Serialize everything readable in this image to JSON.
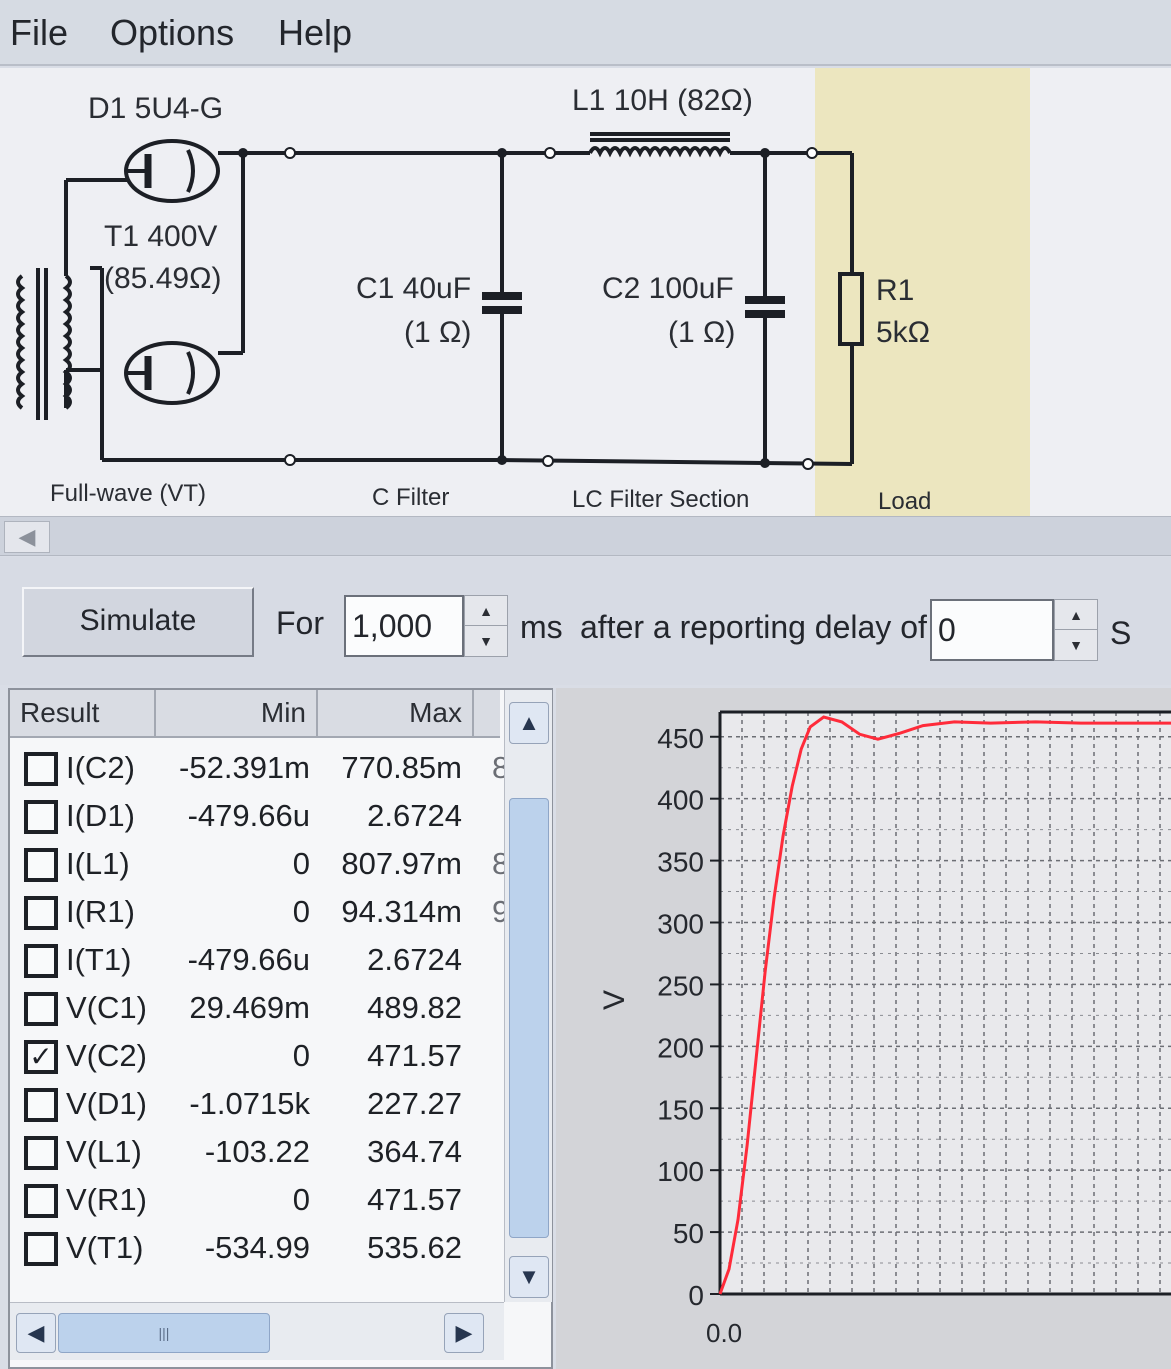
{
  "menu": {
    "file": "File",
    "options": "Options",
    "help": "Help"
  },
  "schematic": {
    "d1_label": "D1 5U4-G",
    "t1_label": "T1 400V",
    "t1_resistance": "(85.49Ω)",
    "l1_label": "L1 10H (82Ω)",
    "c1_label": "C1 40uF",
    "c1_resistance": "(1 Ω)",
    "c2_label": "C2 100uF",
    "c2_resistance": "(1 Ω)",
    "r1_label": "R1",
    "r1_value": "5kΩ",
    "sections": {
      "fullwave": "Full-wave (VT)",
      "c_filter": "C Filter",
      "lc_filter": "LC Filter Section",
      "load": "Load"
    },
    "load_band_color": "#ece6bf"
  },
  "controls": {
    "simulate_label": "Simulate",
    "for_label": "For",
    "duration_value": "1,000",
    "duration_unit": "ms",
    "delay_label": "after a reporting delay of",
    "delay_value": "0",
    "delay_unit": "S"
  },
  "results": {
    "columns": [
      "Result",
      "Min",
      "Max"
    ],
    "rows": [
      {
        "name": "I(C2)",
        "min": "-52.391m",
        "max": "770.85m",
        "checked": false,
        "cut": "8"
      },
      {
        "name": "I(D1)",
        "min": "-479.66u",
        "max": "2.6724",
        "checked": false,
        "cut": ""
      },
      {
        "name": "I(L1)",
        "min": "0",
        "max": "807.97m",
        "checked": false,
        "cut": "8"
      },
      {
        "name": "I(R1)",
        "min": "0",
        "max": "94.314m",
        "checked": false,
        "cut": "9"
      },
      {
        "name": "I(T1)",
        "min": "-479.66u",
        "max": "2.6724",
        "checked": false,
        "cut": ""
      },
      {
        "name": "V(C1)",
        "min": "29.469m",
        "max": "489.82",
        "checked": false,
        "cut": ""
      },
      {
        "name": "V(C2)",
        "min": "0",
        "max": "471.57",
        "checked": true,
        "cut": ""
      },
      {
        "name": "V(D1)",
        "min": "-1.0715k",
        "max": "227.27",
        "checked": false,
        "cut": ""
      },
      {
        "name": "V(L1)",
        "min": "-103.22",
        "max": "364.74",
        "checked": false,
        "cut": ""
      },
      {
        "name": "V(R1)",
        "min": "0",
        "max": "471.57",
        "checked": false,
        "cut": ""
      },
      {
        "name": "V(T1)",
        "min": "-534.99",
        "max": "535.62",
        "checked": false,
        "cut": ""
      }
    ],
    "checkmark": "✓"
  },
  "chart_data": {
    "type": "line",
    "title": "",
    "xlabel": "",
    "ylabel": "V",
    "ylim": [
      0,
      470
    ],
    "yticks": [
      0,
      50,
      100,
      150,
      200,
      250,
      300,
      350,
      400,
      450
    ],
    "xtick_text": "0.0",
    "grid": true,
    "series": [
      {
        "color": "#ff2b3a",
        "points": [
          [
            0,
            0
          ],
          [
            0.02,
            20
          ],
          [
            0.04,
            60
          ],
          [
            0.06,
            120
          ],
          [
            0.08,
            190
          ],
          [
            0.1,
            260
          ],
          [
            0.12,
            320
          ],
          [
            0.14,
            370
          ],
          [
            0.16,
            410
          ],
          [
            0.18,
            440
          ],
          [
            0.2,
            458
          ],
          [
            0.23,
            466
          ],
          [
            0.27,
            462
          ],
          [
            0.31,
            452
          ],
          [
            0.35,
            448
          ],
          [
            0.4,
            453
          ],
          [
            0.45,
            459
          ],
          [
            0.52,
            462
          ],
          [
            0.6,
            461
          ],
          [
            0.7,
            462
          ],
          [
            0.8,
            461
          ],
          [
            0.9,
            461
          ],
          [
            1.0,
            461
          ]
        ]
      }
    ]
  }
}
